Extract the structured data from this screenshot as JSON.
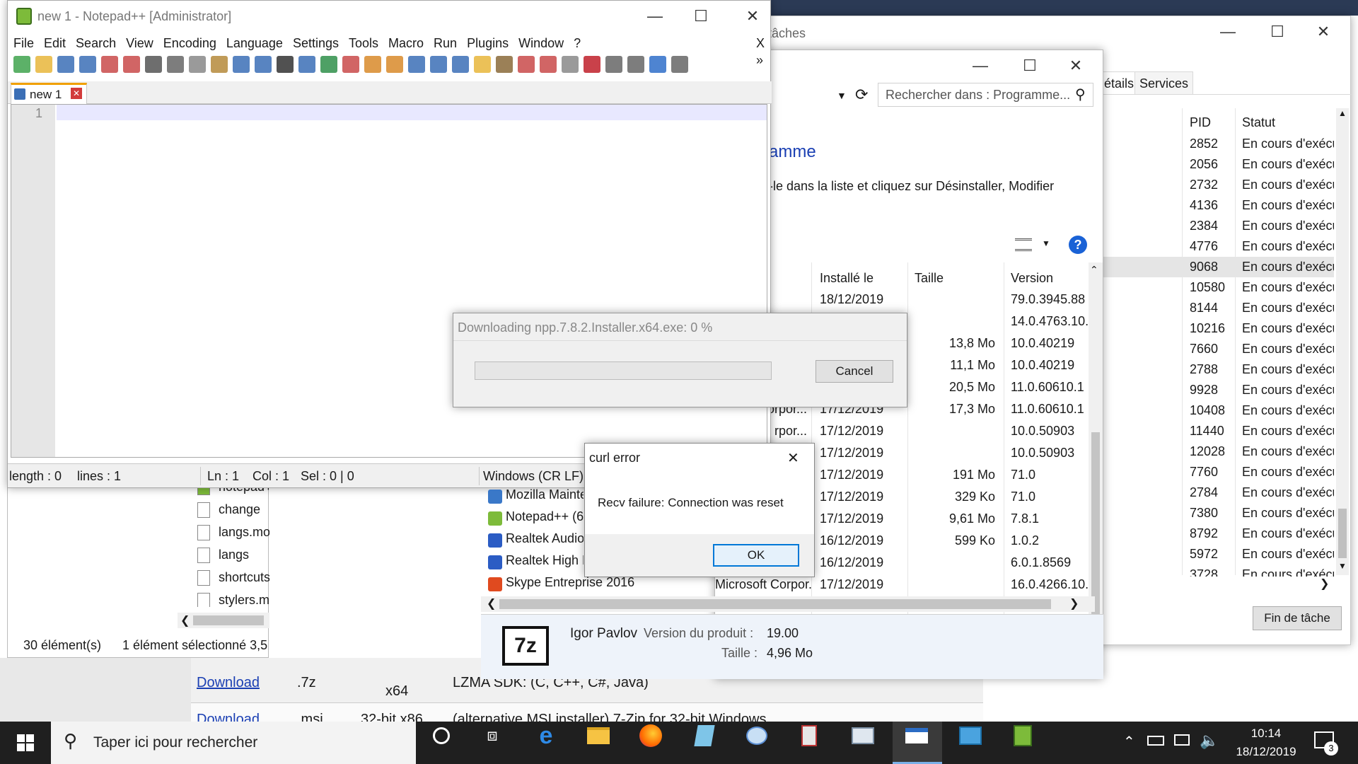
{
  "background_table": {
    "rows": [
      {
        "link": "Download",
        "ext": ".7z",
        "arch": "x64",
        "desc": "LZMA SDK: (C, C++, C#, Java)"
      },
      {
        "link": "Download",
        "ext": ".msi",
        "arch": "32-bit x86",
        "desc": "(alternative MSI installer) 7-Zip for 32-bit Windows"
      }
    ]
  },
  "task_manager": {
    "title_partial": "tâches",
    "tabs": [
      "étails",
      "Services"
    ],
    "columns": {
      "pid": "PID",
      "status": "Statut"
    },
    "rows": [
      {
        "pid": "2852",
        "status": "En cours d'exécu"
      },
      {
        "pid": "2056",
        "status": "En cours d'exécu"
      },
      {
        "pid": "2732",
        "status": "En cours d'exécu"
      },
      {
        "pid": "4136",
        "status": "En cours d'exécu"
      },
      {
        "pid": "2384",
        "status": "En cours d'exécu"
      },
      {
        "pid": "4776",
        "status": "En cours d'exécu"
      },
      {
        "pid": "9068",
        "status": "En cours d'exécu"
      },
      {
        "pid": "10580",
        "status": "En cours d'exécu"
      },
      {
        "pid": "8144",
        "status": "En cours d'exécu"
      },
      {
        "pid": "10216",
        "status": "En cours d'exécu"
      },
      {
        "pid": "7660",
        "status": "En cours d'exécu"
      },
      {
        "pid": "2788",
        "status": "En cours d'exécu"
      },
      {
        "pid": "9928",
        "status": "En cours d'exécu"
      },
      {
        "pid": "10408",
        "status": "En cours d'exécu"
      },
      {
        "pid": "11440",
        "status": "En cours d'exécu"
      },
      {
        "pid": "12028",
        "status": "En cours d'exécu"
      },
      {
        "pid": "7760",
        "status": "En cours d'exécu"
      },
      {
        "pid": "2784",
        "status": "En cours d'exécu"
      },
      {
        "pid": "7380",
        "status": "En cours d'exécu"
      },
      {
        "pid": "8792",
        "status": "En cours d'exécu"
      },
      {
        "pid": "5972",
        "status": "En cours d'exécu"
      },
      {
        "pid": "3728",
        "status": "En cours d'exécu"
      }
    ],
    "end_task_button": "Fin de tâche"
  },
  "programs": {
    "search_placeholder": "Rechercher dans : Programme...",
    "heading_partial": "amme",
    "instruction_partial": "-le dans la liste et cliquez sur Désinstaller, Modifier",
    "columns": {
      "installed": "Installé le",
      "size": "Taille",
      "version": "Version"
    },
    "rows": [
      {
        "name": "",
        "publisher": "",
        "installed": "18/12/2019",
        "size": "",
        "version": "79.0.3945.88"
      },
      {
        "name": "",
        "publisher": "",
        "installed": "",
        "size": "",
        "version": "14.0.4763.10."
      },
      {
        "name": "",
        "publisher": "",
        "installed": "",
        "size": "13,8 Mo",
        "version": "10.0.40219"
      },
      {
        "name": "",
        "publisher": "",
        "installed": "",
        "size": "11,1 Mo",
        "version": "10.0.40219"
      },
      {
        "name": "",
        "publisher": "",
        "installed": "",
        "size": "20,5 Mo",
        "version": "11.0.60610.1"
      },
      {
        "name": "",
        "publisher": "Corpor...",
        "installed": "17/12/2019",
        "size": "17,3 Mo",
        "version": "11.0.60610.1"
      },
      {
        "name": "",
        "publisher": "rpor...",
        "installed": "17/12/2019",
        "size": "",
        "version": "10.0.50903"
      },
      {
        "name": "",
        "publisher": "",
        "installed": "17/12/2019",
        "size": "",
        "version": "10.0.50903"
      },
      {
        "name": "",
        "publisher": "",
        "installed": "17/12/2019",
        "size": "191 Mo",
        "version": "71.0"
      },
      {
        "name": "Mozilla Mainte",
        "publisher": "",
        "installed": "17/12/2019",
        "size": "329 Ko",
        "version": "71.0"
      },
      {
        "name": "Notepad++ (6",
        "publisher": "",
        "installed": "17/12/2019",
        "size": "9,61 Mo",
        "version": "7.8.1"
      },
      {
        "name": "Realtek Audio",
        "publisher": "",
        "installed": "16/12/2019",
        "size": "599 Ko",
        "version": "1.0.2"
      },
      {
        "name": "Realtek High D",
        "publisher": "",
        "installed": "16/12/2019",
        "size": "",
        "version": "6.0.1.8569"
      },
      {
        "name": "Skype Entreprise 2016",
        "publisher": "Microsoft Corpor...",
        "installed": "17/12/2019",
        "size": "",
        "version": "16.0.4266.10."
      }
    ],
    "details": {
      "publisher": "Igor Pavlov",
      "version_label": "Version du produit :",
      "version_value": "19.00",
      "size_label": "Taille :",
      "size_value": "4,96 Mo",
      "logo_text": "7z"
    }
  },
  "explorer": {
    "files": [
      "notepad+",
      "change",
      "langs.mo",
      "langs",
      "shortcuts",
      "stylers.m"
    ],
    "status_count": "30 élément(s)",
    "status_selected": "1 élément sélectionné  3,5"
  },
  "notepad": {
    "title": "new 1 - Notepad++ [Administrator]",
    "menu": [
      "File",
      "Edit",
      "Search",
      "View",
      "Encoding",
      "Language",
      "Settings",
      "Tools",
      "Macro",
      "Run",
      "Plugins",
      "Window",
      "?"
    ],
    "menu_close": "X",
    "tab_label": "new 1",
    "line_number": "1",
    "status": {
      "length": "length : 0",
      "lines": "lines : 1",
      "ln": "Ln : 1",
      "col": "Col : 1",
      "sel": "Sel : 0 | 0",
      "eol": "Windows (CR LF)"
    }
  },
  "download_dialog": {
    "title": "Downloading npp.7.8.2.Installer.x64.exe: 0 %",
    "progress": 0,
    "cancel_label": "Cancel"
  },
  "curl_dialog": {
    "title": "curl error",
    "message": "Recv failure: Connection was reset",
    "ok_label": "OK"
  },
  "taskbar": {
    "search_placeholder": "Taper ici pour rechercher",
    "time": "10:14",
    "date": "18/12/2019",
    "notification_count": "3"
  }
}
